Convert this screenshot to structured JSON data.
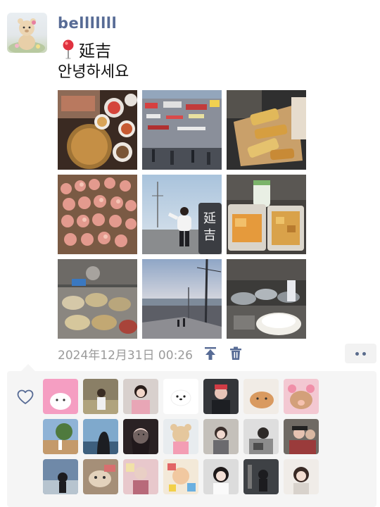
{
  "post": {
    "username": "belllllll",
    "location": "延吉",
    "text": "안녕하세요",
    "timestamp": "2024年12月31日 00:26",
    "pin_icon": "location-pin-icon"
  },
  "actions": {
    "pin_top_icon": "pin-to-top-icon",
    "delete_icon": "trash-icon",
    "more_icon": "more-dots-icon"
  },
  "likes": {
    "icon": "heart-outline-icon",
    "count": 21
  },
  "colors": {
    "username": "#576b95",
    "timestamp": "#9a9a9a",
    "likes_bg": "#f5f5f5",
    "icon_blue": "#576b95"
  }
}
